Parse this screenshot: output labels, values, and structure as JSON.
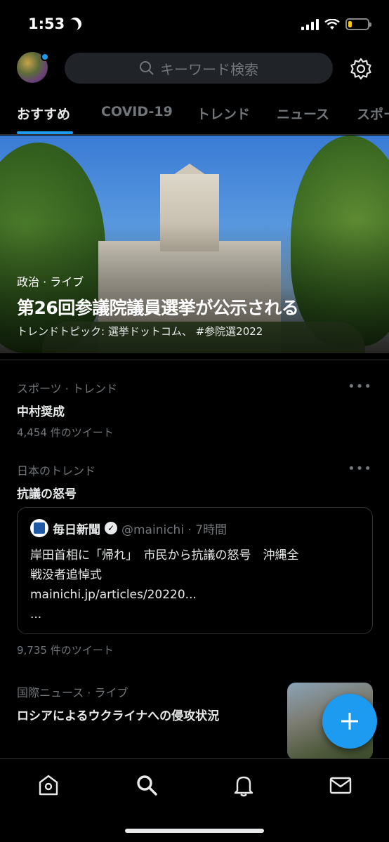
{
  "status_bar": {
    "time": "1:53",
    "battery_level": 0.2
  },
  "search": {
    "placeholder": "キーワード検索"
  },
  "tabs": [
    "おすすめ",
    "COVID-19",
    "トレンド",
    "ニュース",
    "スポー"
  ],
  "hero": {
    "category": "政治 · ライブ",
    "title": "第26回参議院議員選挙が公示される",
    "subtitle": "トレンドトピック: 選挙ドットコム、 #参院選2022"
  },
  "trends": [
    {
      "category": "スポーツ · トレンド",
      "name": "中村奨成",
      "count": "4,454 件のツイート"
    },
    {
      "category": "日本のトレンド",
      "name": "抗議の怒号",
      "count": "9,735 件のツイート"
    }
  ],
  "tweet_card": {
    "name": "毎日新聞",
    "handle": "@mainichi · 7時間",
    "text_line1": "岸田首相に「帰れ」　市民から抗議の怒号　沖縄全",
    "text_line2": "戦没者追悼式",
    "link": "mainichi.jp/articles/20220...",
    "ellipsis": "..."
  },
  "news": {
    "category": "国際ニュース · ライブ",
    "title": "ロシアによるウクライナへの侵攻状況"
  },
  "more_label": "•••",
  "colors": {
    "accent": "#1d9bf0",
    "background": "#000000",
    "muted": "#71767b"
  },
  "icons": [
    "home-icon",
    "search-icon",
    "bell-icon",
    "mail-icon",
    "gear-icon",
    "plus-icon"
  ]
}
